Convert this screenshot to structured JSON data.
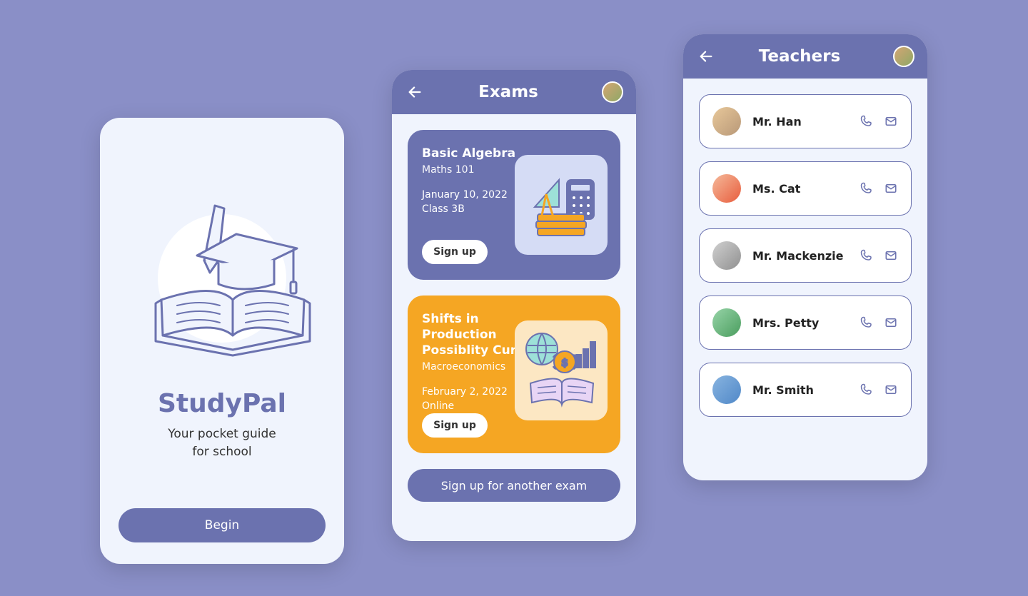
{
  "welcome": {
    "title": "StudyPal",
    "tagline_l1": "Your pocket guide",
    "tagline_l2": "for school",
    "begin_label": "Begin"
  },
  "exams": {
    "title": "Exams",
    "cards": [
      {
        "title": "Basic Algebra",
        "subject": "Maths 101",
        "date": "January 10, 2022",
        "location": "Class 3B",
        "signup_label": "Sign up"
      },
      {
        "title": "Shifts in Production Possiblity Curve",
        "subject": "Macroeconomics",
        "date": "February 2, 2022",
        "location": "Online",
        "signup_label": "Sign up"
      }
    ],
    "another_label": "Sign up for another exam"
  },
  "teachers": {
    "title": "Teachers",
    "list": [
      {
        "name": "Mr. Han"
      },
      {
        "name": "Ms. Cat"
      },
      {
        "name": "Mr. Mackenzie"
      },
      {
        "name": "Mrs. Petty"
      },
      {
        "name": "Mr. Smith"
      }
    ]
  }
}
